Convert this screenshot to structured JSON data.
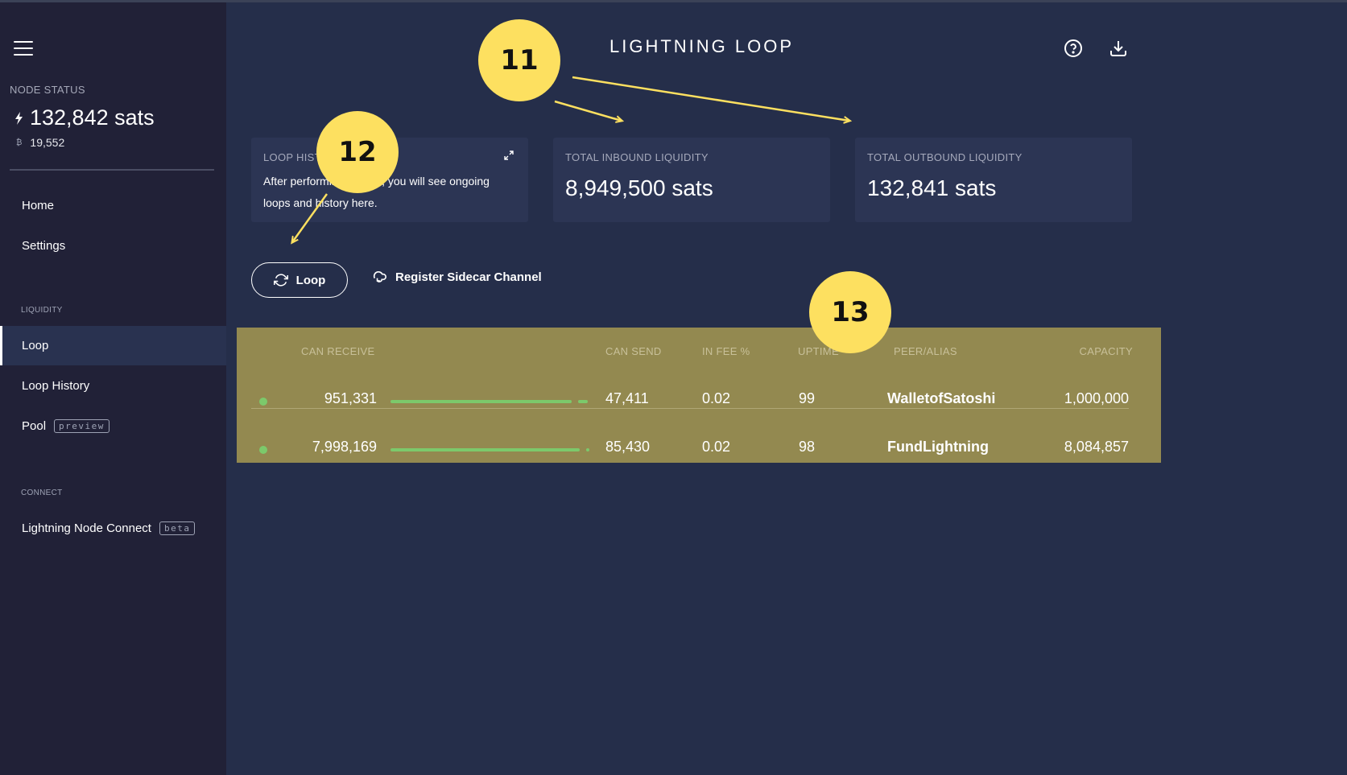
{
  "app": {
    "title": "LIGHTNING LOOP"
  },
  "sidebar": {
    "node_status_label": "NODE STATUS",
    "balance": "132,842 sats",
    "btc_balance": "19,552",
    "nav": [
      {
        "label": "Home"
      },
      {
        "label": "Settings"
      }
    ],
    "liquidity_label": "LIQUIDITY",
    "liquidity_items": [
      {
        "label": "Loop"
      },
      {
        "label": "Loop History"
      },
      {
        "label": "Pool",
        "tag": "preview"
      }
    ],
    "connect_label": "CONNECT",
    "connect_items": [
      {
        "label": "Lightning Node Connect",
        "tag": "beta"
      }
    ]
  },
  "cards": {
    "loop_history": {
      "title": "LOOP HISTORY",
      "text": "After performing a Loop, you will see ongoing loops and history here."
    },
    "inbound": {
      "title": "TOTAL INBOUND LIQUIDITY",
      "value": "8,949,500 sats"
    },
    "outbound": {
      "title": "TOTAL OUTBOUND LIQUIDITY",
      "value": "132,841 sats"
    }
  },
  "actions": {
    "loop_label": "Loop",
    "sidecar_label": "Register Sidecar Channel"
  },
  "table": {
    "headers": {
      "can_receive": "CAN RECEIVE",
      "can_send": "CAN SEND",
      "in_fee": "IN FEE %",
      "uptime": "UPTIME",
      "peer": "PEER/ALIAS",
      "capacity": "CAPACITY"
    },
    "rows": [
      {
        "can_receive": "951,331",
        "can_send": "47,411",
        "in_fee": "0.02",
        "uptime": "99",
        "peer": "WalletofSatoshi",
        "capacity": "1,000,000",
        "inbound_fraction": 0.95
      },
      {
        "can_receive": "7,998,169",
        "can_send": "85,430",
        "in_fee": "0.02",
        "uptime": "98",
        "peer": "FundLightning",
        "capacity": "8,084,857",
        "inbound_fraction": 0.99
      }
    ]
  },
  "annotations": [
    {
      "label": "11"
    },
    {
      "label": "12"
    },
    {
      "label": "13"
    }
  ],
  "colors": {
    "background": "#252e4a",
    "sidebar": "#212137",
    "card": "#2c3554",
    "table_highlight": "#938950",
    "badge": "#fde060",
    "status_green": "#7cc96b"
  },
  "icons": [
    "menu-icon",
    "bolt-icon",
    "bitcoin-icon",
    "help-icon",
    "download-icon",
    "expand-icon",
    "refresh-icon",
    "cloud-sync-icon"
  ]
}
